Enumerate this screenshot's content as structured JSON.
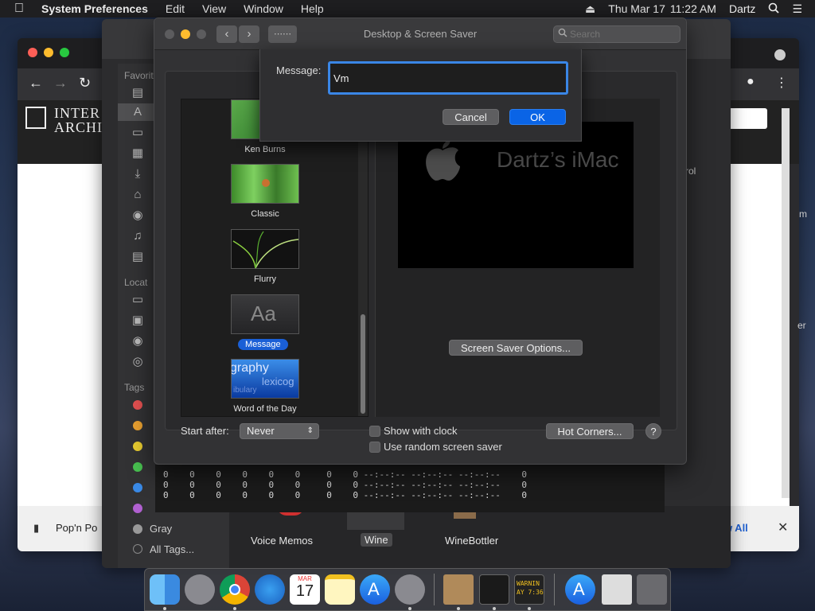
{
  "menubar": {
    "app": "System Preferences",
    "items": [
      "Edit",
      "View",
      "Window",
      "Help"
    ],
    "date": "Thu Mar 17",
    "time": "11:22 AM",
    "user": "Dartz"
  },
  "browser": {
    "logo_line1": "INTER",
    "logo_line2": "ARCHIV",
    "download_item": "Pop'n Po",
    "show_all": "ow All"
  },
  "finder": {
    "sections": {
      "favorites": "Favorit",
      "locations": "Locat",
      "tags": "Tags"
    },
    "tags": [
      {
        "color": "#e25050"
      },
      {
        "color": "#e8a030"
      },
      {
        "color": "#e8cc30"
      },
      {
        "color": "#48c050"
      },
      {
        "color": "#3a8ae6"
      },
      {
        "color": "#b060d0"
      }
    ],
    "gray_label": "Gray",
    "all_tags": "All Tags...",
    "apps": {
      "voice_memos": "Voice Memos",
      "wine": "Wine",
      "winebottler": "WineBottler"
    },
    "edge_text": {
      "a": "rol",
      "b": "m",
      "c": "er"
    }
  },
  "terminal": {
    "rows": [
      "0    0    0    0    0    0     0    0 --:--:-- --:--:-- --:--:--    0",
      "0    0    0    0    0    0     0    0 --:--:-- --:--:-- --:--:--    0",
      "0    0    0    0    0    0     0    0 --:--:-- --:--:-- --:--:--    0"
    ]
  },
  "prefs": {
    "title": "Desktop & Screen Saver",
    "search_placeholder": "Search",
    "savers": [
      {
        "label": "Ken Burns"
      },
      {
        "label": "Classic"
      },
      {
        "label": "Flurry"
      },
      {
        "label": "Message",
        "selected": true,
        "glyph": "Aa"
      },
      {
        "label": "Word of the Day",
        "words": [
          "graphy",
          "lexicog",
          "ibulary"
        ]
      }
    ],
    "preview_text": "Dartz’s iMac",
    "options_button": "Screen Saver Options...",
    "start_after_label": "Start after:",
    "start_after_value": "Never",
    "show_with_clock": "Show with clock",
    "random": "Use random screen saver",
    "hot_corners": "Hot Corners...",
    "help": "?"
  },
  "sheet": {
    "message_label": "Message:",
    "message_value": "Vm",
    "cancel": "Cancel",
    "ok": "OK"
  },
  "dock": {
    "calendar_month": "MAR",
    "calendar_day": "17",
    "console_text": "WARNIN",
    "console_text2": "AY 7:36"
  }
}
